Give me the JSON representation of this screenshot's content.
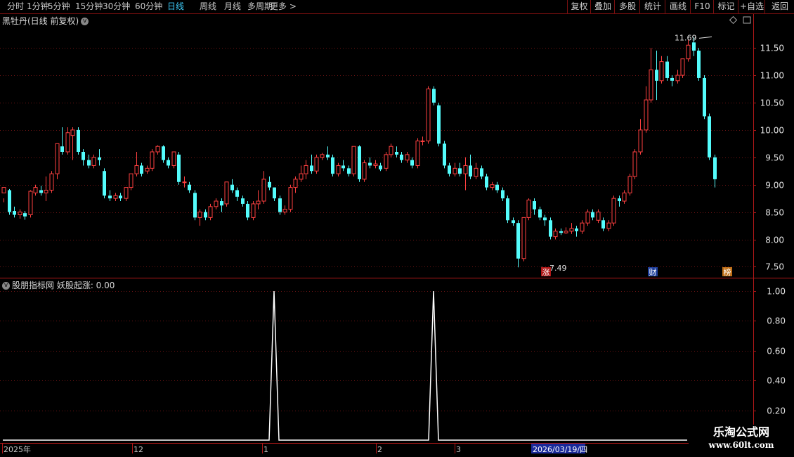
{
  "toolbar": {
    "left_items": [
      "分时",
      "1分钟",
      "5分钟",
      "15分钟",
      "30分钟",
      "60分钟",
      "日线",
      "周线",
      "月线",
      "多周期",
      "更多 >"
    ],
    "active_index": 6,
    "right_items": [
      "复权",
      "叠加",
      "多股",
      "统计",
      "画线",
      "F10",
      "标记",
      "+自选",
      "返回"
    ]
  },
  "main_chart": {
    "title": "黑牡丹(日线 前复权)",
    "high_label": "11.69",
    "low_label": "7.49",
    "y_ticks": [
      "11.50",
      "11.00",
      "10.50",
      "10.00",
      "9.50",
      "9.00",
      "8.50",
      "8.00",
      "7.50"
    ],
    "markers": [
      {
        "text": "涨",
        "bg": "#b01818",
        "color": "#ffffff"
      },
      {
        "text": "财",
        "bg": "#1e3e9a",
        "color": "#ffffff"
      },
      {
        "text": "榜",
        "bg": "#c07018",
        "color": "#ffffff"
      }
    ],
    "colors": {
      "up": "#ff4040",
      "down": "#54fcfc",
      "grid": "#6e1414",
      "axis": "#b01818"
    }
  },
  "indicator": {
    "title": "股朋指标网 妖股起涨: 0.00",
    "y_ticks": [
      "1.00",
      "0.80",
      "0.60",
      "0.40",
      "0.20"
    ]
  },
  "date_axis": {
    "labels": [
      "2025年",
      "12",
      "1",
      "2",
      "3"
    ],
    "cursor_date": "2026/03/19/四"
  },
  "watermark": {
    "line1": "乐淘公式网",
    "line2": "www.60lt.com"
  },
  "chart_data": {
    "type": "candlestick",
    "candles": [
      [
        8.85,
        8.95,
        8.75,
        8.68
      ],
      [
        8.9,
        8.5,
        8.92,
        8.45
      ],
      [
        8.52,
        8.45,
        8.6,
        8.4
      ],
      [
        8.45,
        8.5,
        8.55,
        8.38
      ],
      [
        8.48,
        8.42,
        8.52,
        8.36
      ],
      [
        8.45,
        8.88,
        8.9,
        8.4
      ],
      [
        8.85,
        8.95,
        9.0,
        8.8
      ],
      [
        8.9,
        8.85,
        8.98,
        8.8
      ],
      [
        8.85,
        8.9,
        9.15,
        8.7
      ],
      [
        8.9,
        9.2,
        9.25,
        8.85
      ],
      [
        9.2,
        9.75,
        9.75,
        9.1
      ],
      [
        9.7,
        9.6,
        10.05,
        9.55
      ],
      [
        9.6,
        9.95,
        10.05,
        9.55
      ],
      [
        9.9,
        10.0,
        10.05,
        9.45
      ],
      [
        10.0,
        9.6,
        10.05,
        9.55
      ],
      [
        9.6,
        9.45,
        9.65,
        9.35
      ],
      [
        9.45,
        9.35,
        9.55,
        9.3
      ],
      [
        9.35,
        9.5,
        9.55,
        9.3
      ],
      [
        9.5,
        9.45,
        9.65,
        9.35
      ],
      [
        9.25,
        8.8,
        9.3,
        8.75
      ],
      [
        8.8,
        8.75,
        8.9,
        8.7
      ],
      [
        8.75,
        8.8,
        8.85,
        8.7
      ],
      [
        8.8,
        8.75,
        8.85,
        8.7
      ],
      [
        8.75,
        8.95,
        8.95,
        8.7
      ],
      [
        8.95,
        9.2,
        9.2,
        8.9
      ],
      [
        9.2,
        9.35,
        9.6,
        9.15
      ],
      [
        9.35,
        9.2,
        9.4,
        9.15
      ],
      [
        9.25,
        9.3,
        9.35,
        9.2
      ],
      [
        9.3,
        9.6,
        9.65,
        9.25
      ],
      [
        9.6,
        9.7,
        9.72,
        9.55
      ],
      [
        9.7,
        9.45,
        9.72,
        9.4
      ],
      [
        9.45,
        9.35,
        9.5,
        9.3
      ],
      [
        9.35,
        9.6,
        9.6,
        9.3
      ],
      [
        9.55,
        9.05,
        9.6,
        9.0
      ],
      [
        9.05,
        9.05,
        9.15,
        8.95
      ],
      [
        9.0,
        8.9,
        9.05,
        8.85
      ],
      [
        8.85,
        8.4,
        8.9,
        8.35
      ],
      [
        8.4,
        8.5,
        8.55,
        8.25
      ],
      [
        8.5,
        8.4,
        8.55,
        8.35
      ],
      [
        8.4,
        8.6,
        8.65,
        8.35
      ],
      [
        8.6,
        8.7,
        8.75,
        8.55
      ],
      [
        8.7,
        8.62,
        8.75,
        8.5
      ],
      [
        8.65,
        9.05,
        9.05,
        8.6
      ],
      [
        9.0,
        8.9,
        9.1,
        8.85
      ],
      [
        8.9,
        8.78,
        8.95,
        8.7
      ],
      [
        8.75,
        8.65,
        8.8,
        8.6
      ],
      [
        8.65,
        8.4,
        8.7,
        8.35
      ],
      [
        8.4,
        8.65,
        8.7,
        8.35
      ],
      [
        8.65,
        8.7,
        8.9,
        8.55
      ],
      [
        8.7,
        9.1,
        9.25,
        8.65
      ],
      [
        9.05,
        8.95,
        9.15,
        8.9
      ],
      [
        8.95,
        8.75,
        8.95,
        8.7
      ],
      [
        8.75,
        8.5,
        8.8,
        8.45
      ],
      [
        8.5,
        8.55,
        8.62,
        8.45
      ],
      [
        8.55,
        8.95,
        9.0,
        8.5
      ],
      [
        8.95,
        9.1,
        9.15,
        8.85
      ],
      [
        9.1,
        9.2,
        9.35,
        9.05
      ],
      [
        9.2,
        9.35,
        9.45,
        9.1
      ],
      [
        9.35,
        9.25,
        9.55,
        9.2
      ],
      [
        9.25,
        9.5,
        9.55,
        9.2
      ],
      [
        9.5,
        9.55,
        9.58,
        9.45
      ],
      [
        9.55,
        9.5,
        9.7,
        9.45
      ],
      [
        9.5,
        9.2,
        9.55,
        9.15
      ],
      [
        9.2,
        9.35,
        9.4,
        9.15
      ],
      [
        9.35,
        9.3,
        9.45,
        9.25
      ],
      [
        9.3,
        9.2,
        9.35,
        9.15
      ],
      [
        9.2,
        9.7,
        9.7,
        9.15
      ],
      [
        9.7,
        9.1,
        9.72,
        9.05
      ],
      [
        9.1,
        9.4,
        9.45,
        9.05
      ],
      [
        9.4,
        9.35,
        9.5,
        9.3
      ],
      [
        9.35,
        9.38,
        9.45,
        9.3
      ],
      [
        9.35,
        9.28,
        9.4,
        9.25
      ],
      [
        9.3,
        9.55,
        9.6,
        9.25
      ],
      [
        9.55,
        9.7,
        9.75,
        9.5
      ],
      [
        9.6,
        9.55,
        9.7,
        9.5
      ],
      [
        9.55,
        9.45,
        9.6,
        9.4
      ],
      [
        9.45,
        9.55,
        9.6,
        9.4
      ],
      [
        9.45,
        9.35,
        9.5,
        9.3
      ],
      [
        9.35,
        9.8,
        9.85,
        9.3
      ],
      [
        9.8,
        9.8,
        9.88,
        9.72
      ],
      [
        9.8,
        10.75,
        10.8,
        9.75
      ],
      [
        10.75,
        10.5,
        10.8,
        10.45
      ],
      [
        10.45,
        9.75,
        10.5,
        9.7
      ],
      [
        9.75,
        9.35,
        9.8,
        9.3
      ],
      [
        9.35,
        9.2,
        9.4,
        9.15
      ],
      [
        9.2,
        9.3,
        9.4,
        9.15
      ],
      [
        9.3,
        9.2,
        9.4,
        9.15
      ],
      [
        9.2,
        9.35,
        9.5,
        8.9
      ],
      [
        9.35,
        9.15,
        9.55,
        9.1
      ],
      [
        9.15,
        9.3,
        9.4,
        9.1
      ],
      [
        9.3,
        9.15,
        9.35,
        9.1
      ],
      [
        9.15,
        8.95,
        9.2,
        8.9
      ],
      [
        8.95,
        9.0,
        9.05,
        8.9
      ],
      [
        9.0,
        8.9,
        9.05,
        8.85
      ],
      [
        8.9,
        8.75,
        8.95,
        8.7
      ],
      [
        8.75,
        8.35,
        8.8,
        8.3
      ],
      [
        8.35,
        8.3,
        8.4,
        8.25
      ],
      [
        8.3,
        7.65,
        8.35,
        7.49
      ],
      [
        7.65,
        8.4,
        8.4,
        7.6
      ],
      [
        8.4,
        8.72,
        8.75,
        8.35
      ],
      [
        8.7,
        8.55,
        8.75,
        8.45
      ],
      [
        8.55,
        8.4,
        8.6,
        8.35
      ],
      [
        8.4,
        8.35,
        8.45,
        8.25
      ],
      [
        8.35,
        8.05,
        8.4,
        8.0
      ],
      [
        8.05,
        8.15,
        8.2,
        8.0
      ],
      [
        8.15,
        8.12,
        8.2,
        8.08
      ],
      [
        8.12,
        8.15,
        8.22,
        8.1
      ],
      [
        8.15,
        8.2,
        8.3,
        8.1
      ],
      [
        8.2,
        8.15,
        8.25,
        8.05
      ],
      [
        8.15,
        8.3,
        8.35,
        8.1
      ],
      [
        8.3,
        8.5,
        8.55,
        8.25
      ],
      [
        8.5,
        8.4,
        8.55,
        8.35
      ],
      [
        8.35,
        8.5,
        8.55,
        8.3
      ],
      [
        8.35,
        8.2,
        8.4,
        8.15
      ],
      [
        8.2,
        8.3,
        8.35,
        8.15
      ],
      [
        8.3,
        8.75,
        8.8,
        8.25
      ],
      [
        8.75,
        8.7,
        8.8,
        8.6
      ],
      [
        8.7,
        8.85,
        8.9,
        8.65
      ],
      [
        8.85,
        9.15,
        9.2,
        8.8
      ],
      [
        9.15,
        9.6,
        9.65,
        9.1
      ],
      [
        9.6,
        10.0,
        10.2,
        9.55
      ],
      [
        10.0,
        10.55,
        10.8,
        9.95
      ],
      [
        10.55,
        11.1,
        11.5,
        10.5
      ],
      [
        11.1,
        10.9,
        11.45,
        10.55
      ],
      [
        10.9,
        11.25,
        11.35,
        10.85
      ],
      [
        11.25,
        10.95,
        11.35,
        10.9
      ],
      [
        10.95,
        10.9,
        11.0,
        10.8
      ],
      [
        10.9,
        11.0,
        11.1,
        10.85
      ],
      [
        11.0,
        11.3,
        11.3,
        10.95
      ],
      [
        11.3,
        11.55,
        11.65,
        11.25
      ],
      [
        11.6,
        11.45,
        11.69,
        11.35
      ],
      [
        11.45,
        10.95,
        11.5,
        10.9
      ],
      [
        10.95,
        10.25,
        11.0,
        10.2
      ],
      [
        10.25,
        9.5,
        10.3,
        9.45
      ],
      [
        9.5,
        9.1,
        9.55,
        8.95
      ]
    ],
    "signal_x": [
      "1",
      "3"
    ],
    "signal_values": [
      1.0,
      1.0
    ],
    "price_ylim": [
      7.3,
      11.9
    ],
    "indicator_ylim": [
      0,
      1.0
    ]
  }
}
